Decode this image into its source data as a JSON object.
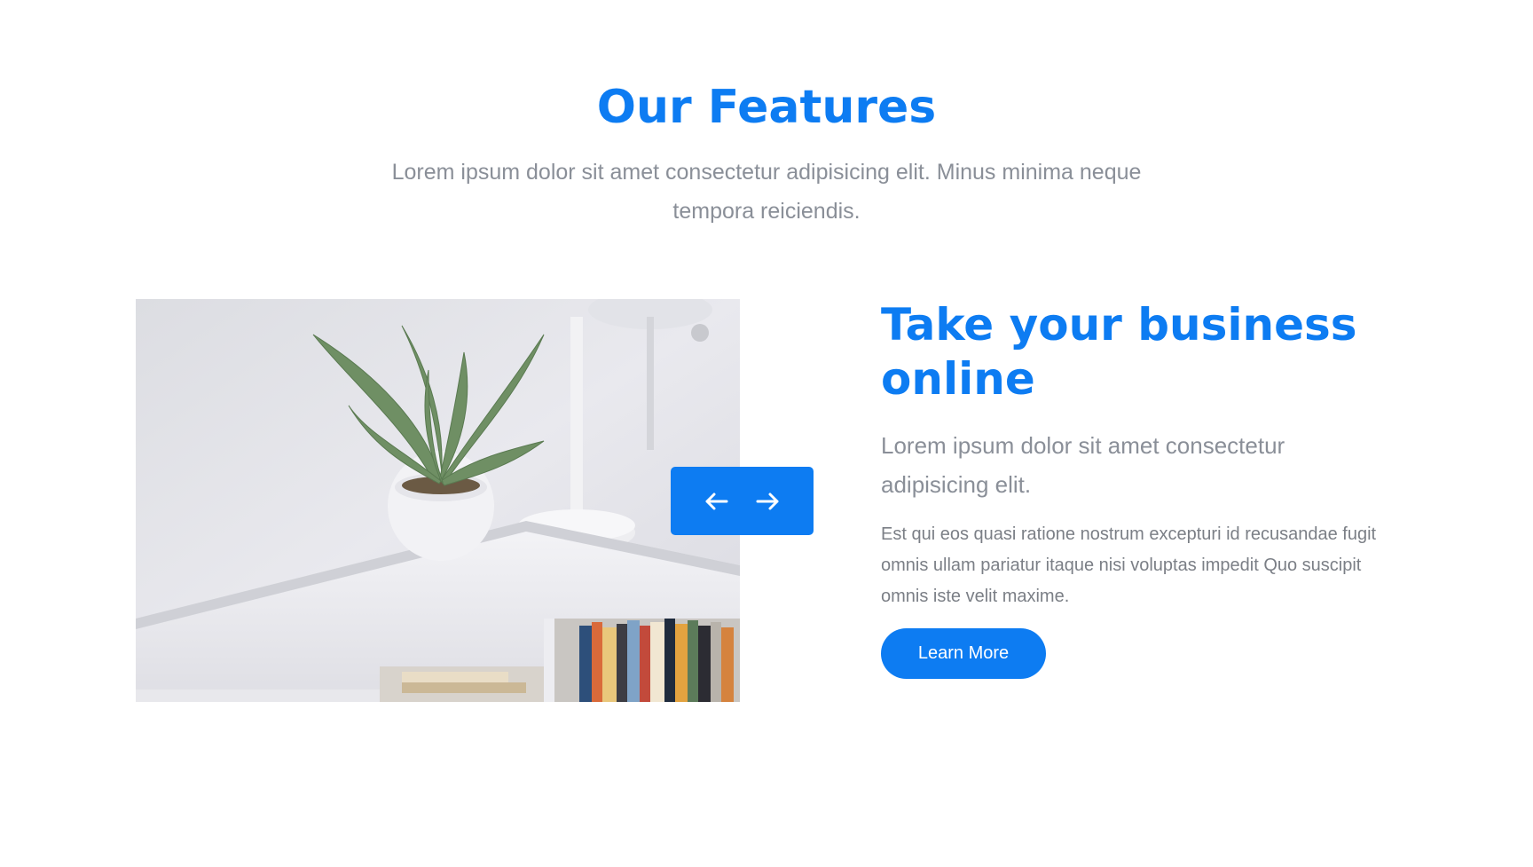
{
  "section": {
    "title": "Our Features",
    "subtitle": "Lorem ipsum dolor sit amet consectetur adipisicing elit. Minus minima neque tempora reiciendis."
  },
  "slider": {
    "prev_icon": "arrow-left-icon",
    "next_icon": "arrow-right-icon"
  },
  "feature": {
    "heading": "Take your business online",
    "lead": "Lorem ipsum dolor sit amet consectetur adipisicing elit.",
    "body": "Est qui eos quasi ratione nostrum excepturi id recusandae fugit omnis ullam pariatur itaque nisi voluptas impedit Quo suscipit omnis iste velit maxime.",
    "button_label": "Learn More"
  },
  "colors": {
    "accent": "#0d7cf2",
    "muted_text": "#8a8f98"
  }
}
